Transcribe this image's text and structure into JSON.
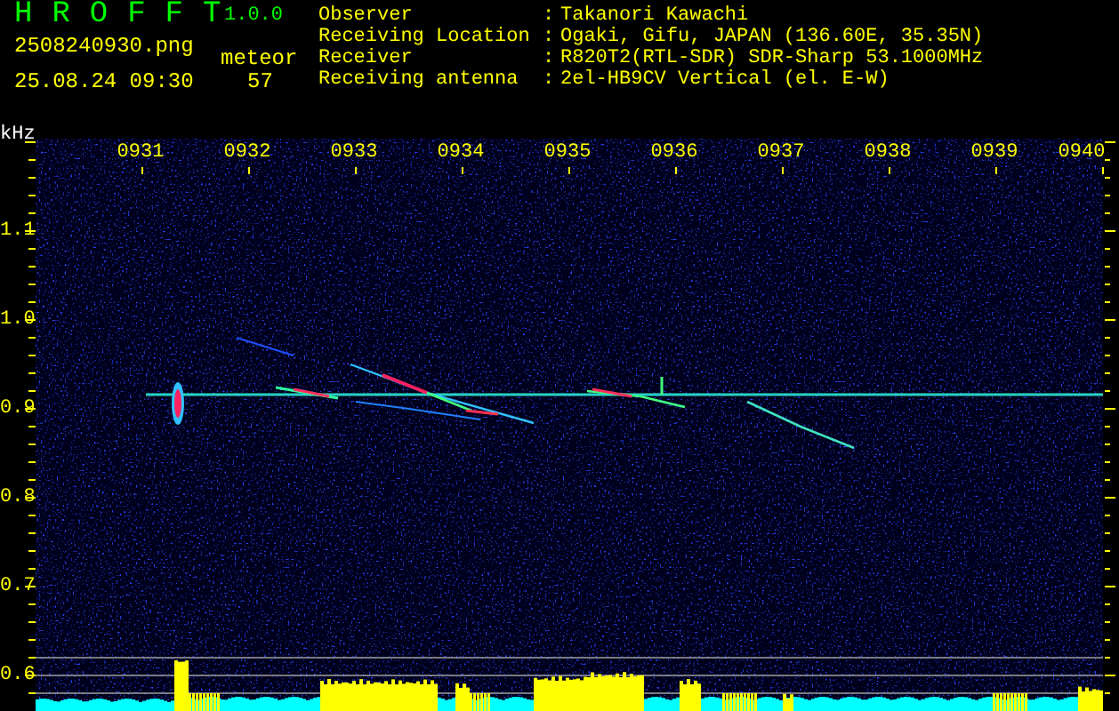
{
  "app": {
    "name": "HROFFT",
    "version": "1.0.0"
  },
  "file": {
    "name": "2508240930.png",
    "timestamp": "25.08.24 09:30"
  },
  "meteor": {
    "label": "meteor",
    "count": "57"
  },
  "info": [
    {
      "label": "Observer",
      "separator": ":",
      "value": "Takanori Kawachi"
    },
    {
      "label": "Receiving Location",
      "separator": ":",
      "value": "Ogaki, Gifu, JAPAN (136.60E, 35.35N)"
    },
    {
      "label": "Receiver",
      "separator": ":",
      "value": "R820T2(RTL-SDR) SDR-Sharp 53.1000MHz"
    },
    {
      "label": "Receiving antenna",
      "separator": ":",
      "value": "2el-HB9CV Vertical (el. E-W)"
    }
  ],
  "spectrogram": {
    "y_unit": "kHz",
    "x_labels": [
      "0931",
      "0932",
      "0933",
      "0934",
      "0935",
      "0936",
      "0937",
      "0938",
      "0939",
      "0940"
    ],
    "y_labels": [
      "1.1",
      "1.0",
      "0.9",
      "0.8",
      "0.7",
      "0.6"
    ]
  }
}
